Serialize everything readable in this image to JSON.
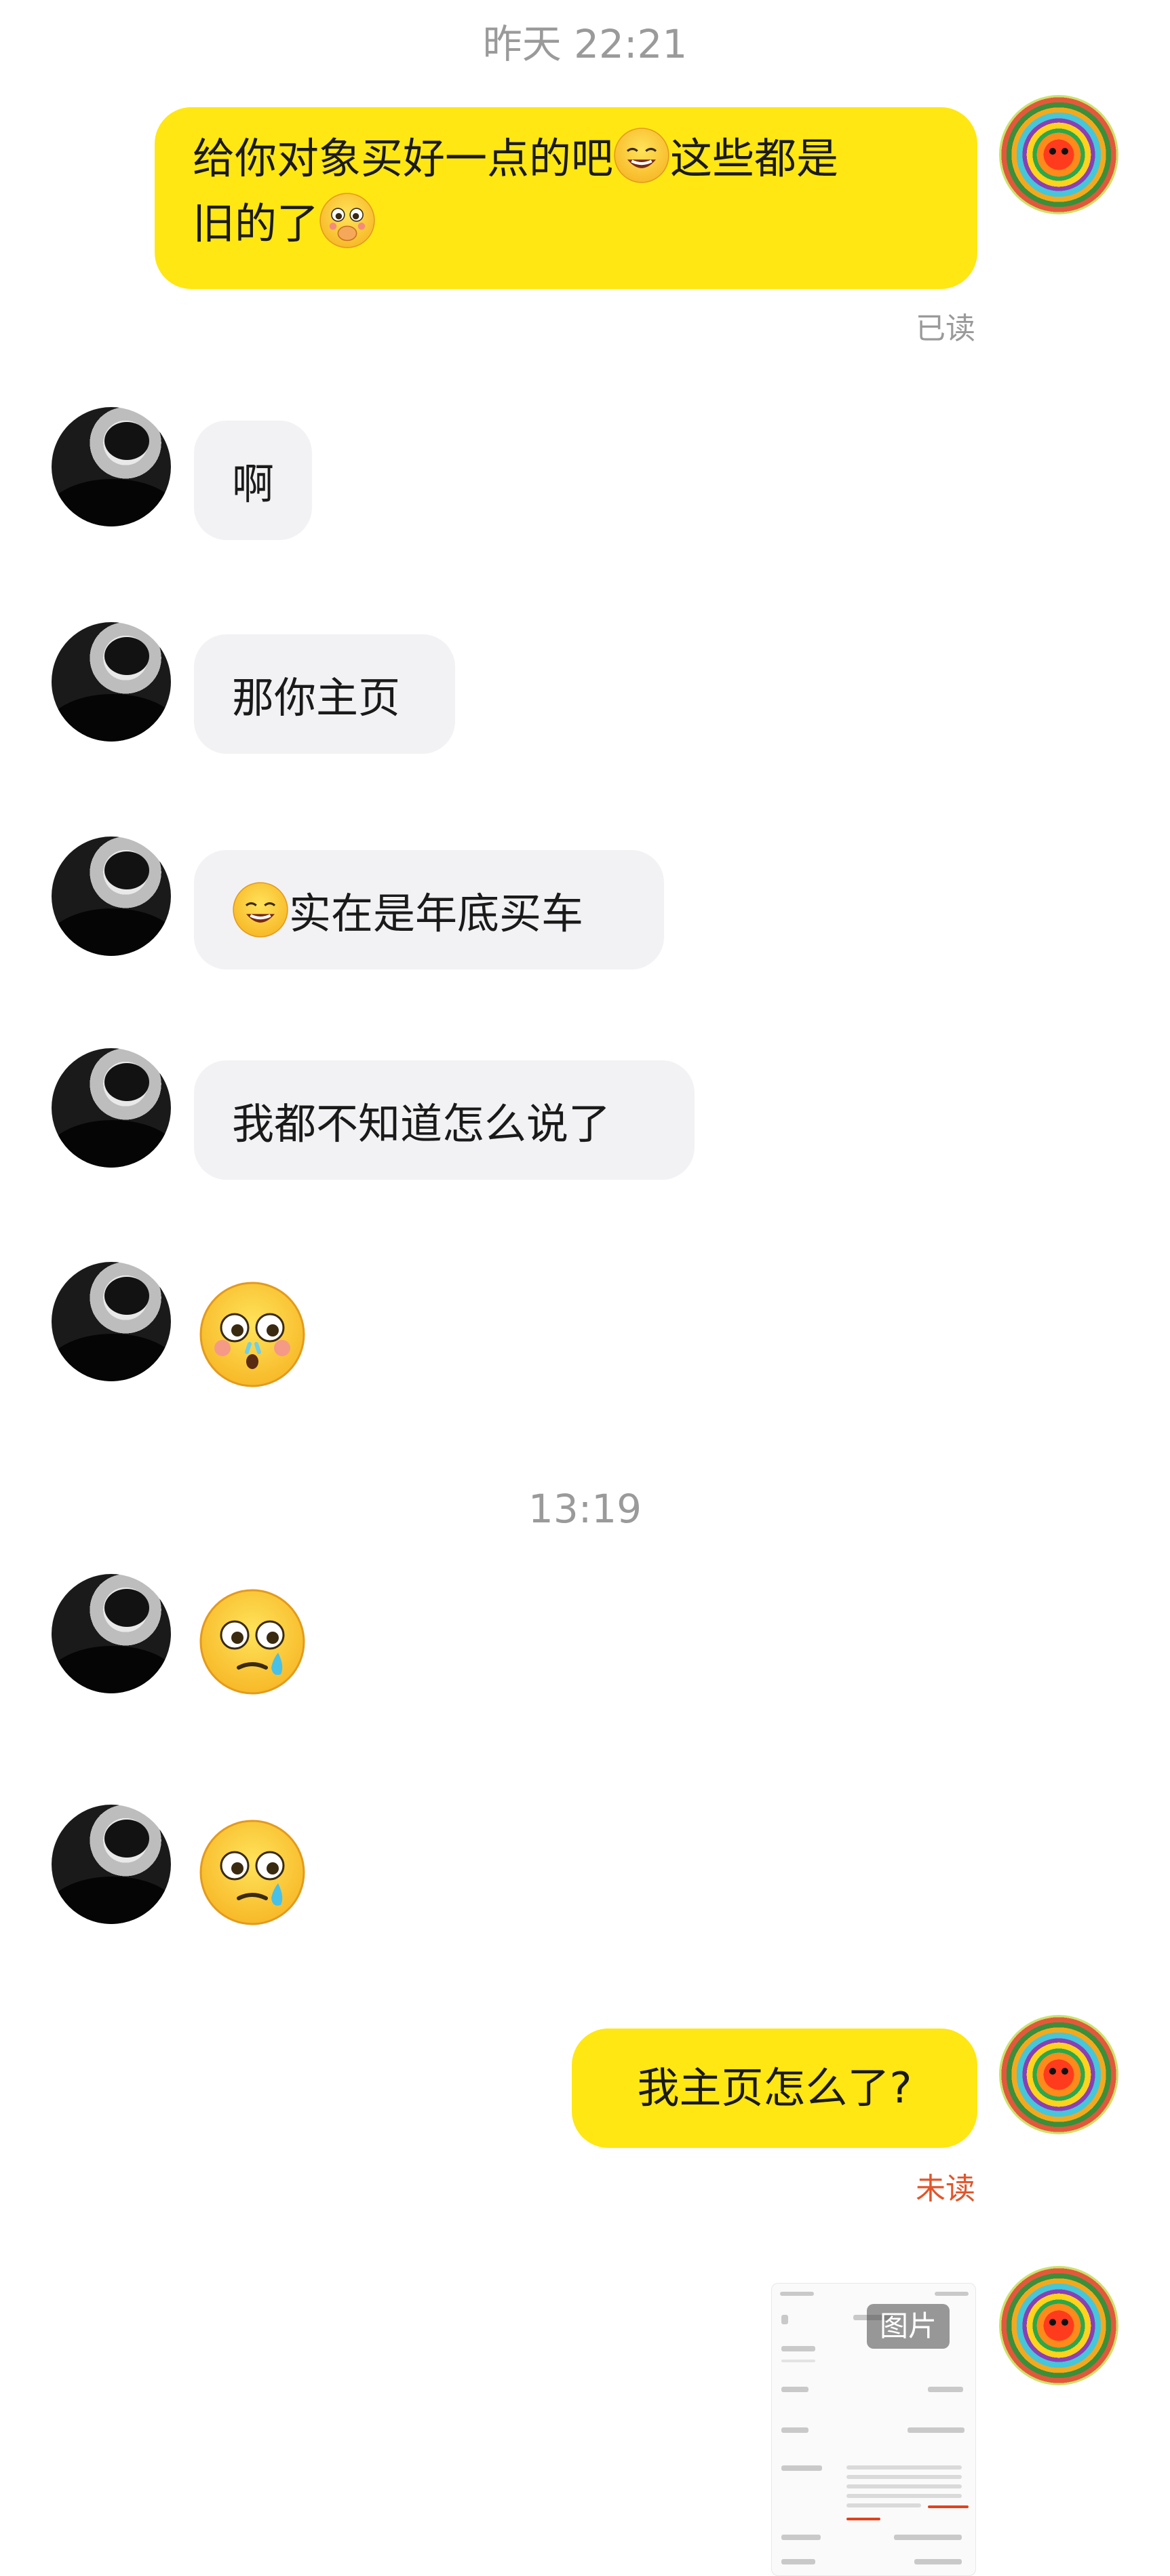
{
  "timestamps": [
    "昨天 22:21",
    "13:19"
  ],
  "messages": {
    "m1_line1": "给你对象买好一点的吧",
    "m1_line1b": "这些都是",
    "m1_line2": "旧的了",
    "m1_status": "已读",
    "m2": "啊",
    "m3": "那你主页",
    "m4": "实在是年底买车",
    "m5": "我都不知道怎么说了",
    "m6": "我主页怎么了?",
    "m6_status": "未读",
    "image_tag": "图片"
  },
  "icons": {
    "self_avatar": "colorful-swirl-avatar",
    "other_avatar": "dark-portrait-avatar",
    "emoji_grin": "grinning-sweat-emoji",
    "emoji_shy": "blushing-pleading-emoji",
    "emoji_nosebleed": "shocked-nosebleed-emoji",
    "emoji_tear": "teary-emoji"
  },
  "colors": {
    "outgoing_bubble": "#fee713",
    "incoming_bubble": "#f2f2f4",
    "read_status": "#9a9a9a",
    "unread_status": "#e0562b",
    "timestamp": "#9a9a9a"
  }
}
